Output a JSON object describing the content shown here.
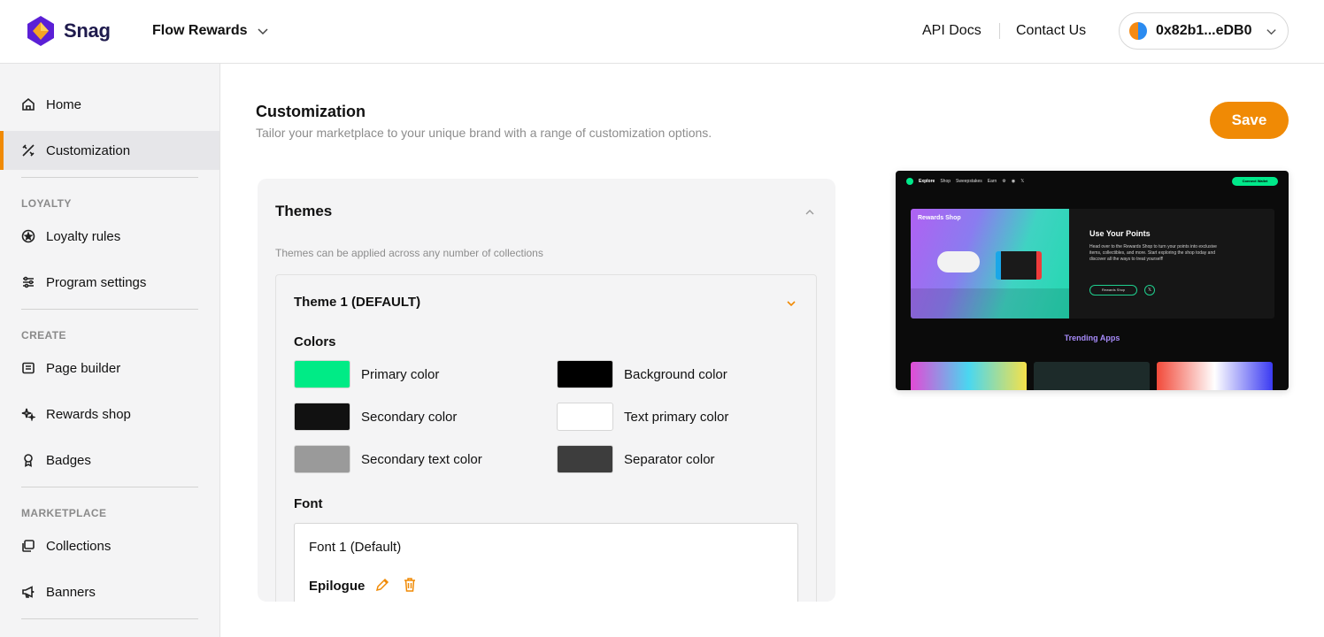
{
  "header": {
    "brand": "Snag",
    "project": "Flow Rewards",
    "api_docs": "API Docs",
    "contact": "Contact Us",
    "wallet_address": "0x82b1...eDB0"
  },
  "sidebar": {
    "home": "Home",
    "customization": "Customization",
    "section_loyalty": "LOYALTY",
    "loyalty_rules": "Loyalty rules",
    "program_settings": "Program settings",
    "section_create": "CREATE",
    "page_builder": "Page builder",
    "rewards_shop": "Rewards shop",
    "badges": "Badges",
    "section_marketplace": "MARKETPLACE",
    "collections": "Collections",
    "banners": "Banners"
  },
  "main": {
    "title": "Customization",
    "subtitle": "Tailor your marketplace to your unique brand with a range of customization options.",
    "save_label": "Save",
    "themes": {
      "title": "Themes",
      "description": "Themes can be applied across any number of collections",
      "theme_title": "Theme 1 (DEFAULT)",
      "colors_label": "Colors",
      "colors": [
        {
          "label": "Primary color",
          "hex": "#00EB86"
        },
        {
          "label": "Background color",
          "hex": "#000000"
        },
        {
          "label": "Secondary color",
          "hex": "#111111"
        },
        {
          "label": "Text primary color",
          "hex": "#FFFFFF"
        },
        {
          "label": "Secondary text color",
          "hex": "#9A9A9A"
        },
        {
          "label": "Separator color",
          "hex": "#3D3D3D"
        }
      ],
      "font_label": "Font",
      "font_name": "Font 1 (Default)",
      "font_family": "Epilogue"
    }
  },
  "preview": {
    "nav": [
      "Explore",
      "Shop",
      "Sweepstakes",
      "Earn"
    ],
    "connect": "Connect Wallet",
    "hero_label": "Rewards Shop",
    "hero_title": "Use Your Points",
    "hero_body": "Head over to the Rewards Shop to turn your points into exclusive items, collectibles, and more. Start exploring the shop today and discover all the ways to treat yourself!",
    "hero_button": "Rewards Shop",
    "trending": "Trending Apps"
  },
  "colors": {
    "accent": "#F08A05",
    "active_bg": "#E6E6E9",
    "sidebar_bg": "#F4F4F5"
  }
}
